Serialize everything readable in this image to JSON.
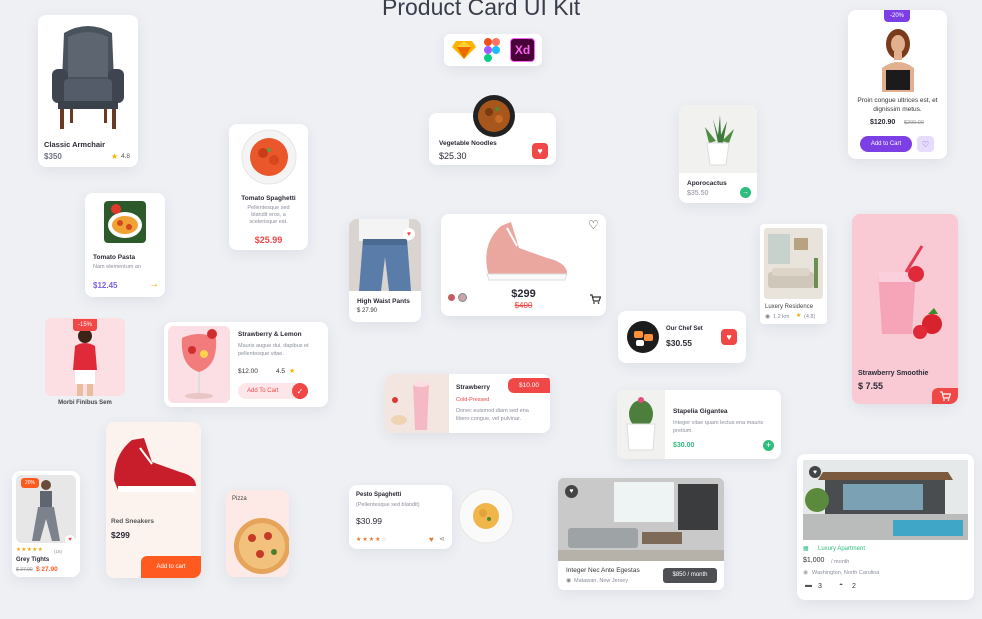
{
  "header": {
    "title": "Product Card UI Kit",
    "tools": [
      "sketch-icon",
      "figma-icon",
      "xd-icon"
    ],
    "xd_label": "Xd"
  },
  "armchair": {
    "name": "Classic Armchair",
    "price": "$350",
    "rating": "4.8"
  },
  "spaghetti": {
    "name": "Tomato Spaghetti",
    "desc": "Pellentesque sed blandit eros, a scelerisque est.",
    "price": "$25.99"
  },
  "noodles": {
    "name": "Vegetable Noodles",
    "price": "$25.30"
  },
  "aporocactus": {
    "name": "Aporocactus",
    "price": "$35.50"
  },
  "promo": {
    "badge": "-20%",
    "text": "Proin congue ultrices est, et dignissim metus.",
    "price": "$120.90",
    "old_price": "$200.00",
    "button": "Add to Cart"
  },
  "pasta": {
    "name": "Tomato Pasta",
    "desc": "Nam elementum an",
    "price": "$12.45"
  },
  "pants": {
    "name": "High Waist Pants",
    "price": "$ 27.90"
  },
  "sneaker": {
    "price": "$299",
    "old_price": "$400",
    "swatches": [
      "#c45c63",
      "#c9a4a8"
    ]
  },
  "residence": {
    "name": "Luxery Residence",
    "distance": "1.2 km",
    "rating": "(4.8)"
  },
  "smoothie": {
    "name": "Strawberry Smoothie",
    "price": "$ 7.55"
  },
  "morbi": {
    "badge": "-15%",
    "name": "Morbi Finibus Sem"
  },
  "lemon": {
    "name": "Strawberry & Lemon",
    "desc": "Mauris augue dui, dapibus et pellentesque vitae.",
    "price": "$12.00",
    "rating": "4.5",
    "button": "Add To Cart"
  },
  "strawberry": {
    "name": "Strawberry",
    "price": "$10.00",
    "tag": "Cold-Pressed",
    "desc": "Donec euismod diam sed ena libero congue, vel pulvinar."
  },
  "chef": {
    "name": "Our Chef Set",
    "price": "$30.55"
  },
  "stapelia": {
    "name": "Stapelia Gigantea",
    "desc": "Integer vitae quam lectus ena mauris pretium.",
    "price": "$30.00"
  },
  "red_sneakers": {
    "name": "Red Sneakers",
    "price": "$299",
    "button": "Add to cart"
  },
  "pizza": {
    "name": "Pizza"
  },
  "pesto": {
    "name": "Pesto Spaghetti",
    "desc": "(Pellentesque sed blandit)",
    "price": "$30.99"
  },
  "tights": {
    "badge": "20%",
    "count": "(16)",
    "name": "Grey Tights",
    "old_price": "$ 37.90",
    "price": "$ 27.90"
  },
  "apartment_nj": {
    "name": "Integer Nec Ante Egestas",
    "location": "Matawan, New Jersey",
    "price": "$850 / month"
  },
  "luxury": {
    "tag": "Luxury Apartment",
    "price": "$1,000",
    "per": "/ month",
    "location": "Washington, North Carolina",
    "beds": "3",
    "baths": "2"
  },
  "colors": {
    "accent_red": "#f04747",
    "accent_orange": "#ff5a1f",
    "accent_purple": "#7b3fe4",
    "accent_green": "#2ebd7f",
    "pink_bg": "#f9c9d4"
  }
}
